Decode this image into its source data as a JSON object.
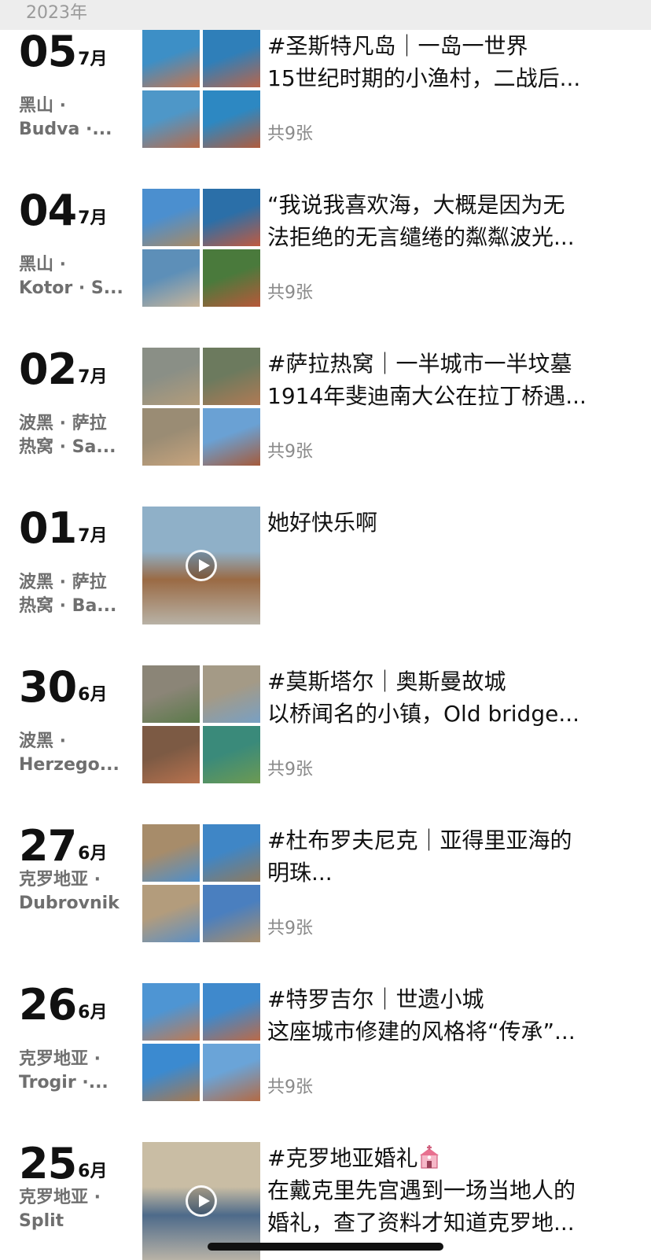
{
  "header": {
    "year": "2023年"
  },
  "posts": [
    {
      "day": "05",
      "month": "7月",
      "location_lines": [
        "黑山 ·",
        "Budva ·..."
      ],
      "title": "#圣斯特凡岛｜一岛一世界",
      "desc": "15世纪时期的小渔村，二战后...",
      "count": "共9张",
      "media": "grid",
      "thumb_colors": [
        [
          "#3d8fc6",
          "#c8744c"
        ],
        [
          "#2f7fb9",
          "#b9654a"
        ],
        [
          "#4e97c8",
          "#b96a48"
        ],
        [
          "#2d88c2",
          "#b15c3d"
        ]
      ]
    },
    {
      "day": "04",
      "month": "7月",
      "location_lines": [
        "黑山 ·",
        "Kotor · S..."
      ],
      "title": "“我说我喜欢海，大概是因为无",
      "desc": "法拒绝的无言缱绻的粼粼波光...",
      "count": "共9张",
      "media": "grid",
      "thumb_colors": [
        [
          "#4b8fcf",
          "#a98a64"
        ],
        [
          "#2b6fa8",
          "#c15a3f"
        ],
        [
          "#5d8fb8",
          "#c9b59a"
        ],
        [
          "#4a7a3c",
          "#b8583a"
        ]
      ]
    },
    {
      "day": "02",
      "month": "7月",
      "location_lines": [
        "波黑 · 萨拉",
        "热窝 · Sa..."
      ],
      "title": "#萨拉热窝｜一半城市一半坟墓",
      "desc": "1914年斐迪南大公在拉丁桥遇...",
      "count": "共9张",
      "media": "grid",
      "thumb_colors": [
        [
          "#8a8f86",
          "#b39c7a"
        ],
        [
          "#6c7a5e",
          "#b07a54"
        ],
        [
          "#9a8c74",
          "#c7a47d"
        ],
        [
          "#6aa1d4",
          "#a55a3a"
        ]
      ]
    },
    {
      "day": "01",
      "month": "7月",
      "location_lines": [
        "波黑 · 萨拉",
        "热窝 · Ba..."
      ],
      "title": "她好快乐啊",
      "desc": "",
      "count": "",
      "media": "video",
      "thumb_colors": [
        [
          "#8fb0c8",
          "#9a6a44"
        ]
      ]
    },
    {
      "day": "30",
      "month": "6月",
      "location_lines": [
        "波黑 ·",
        "Herzego..."
      ],
      "title": "#莫斯塔尔｜奥斯曼故城",
      "desc": "以桥闻名的小镇，Old bridge...",
      "count": "共9张",
      "media": "grid",
      "thumb_colors": [
        [
          "#8b8577",
          "#5b7a4a"
        ],
        [
          "#a49a86",
          "#78a0c4"
        ],
        [
          "#7c5a44",
          "#b8724e"
        ],
        [
          "#3a8a7a",
          "#6d9a52"
        ]
      ]
    },
    {
      "day": "27",
      "month": "6月",
      "location_lines": [
        "克罗地亚 ·",
        "Dubrovnik"
      ],
      "title": "#杜布罗夫尼克｜亚得里亚海的",
      "desc": "明珠...",
      "count": "共9张",
      "media": "grid",
      "thumb_colors": [
        [
          "#a78c6a",
          "#4d8fcc"
        ],
        [
          "#3f86c6",
          "#8f7a5e"
        ],
        [
          "#b39c7c",
          "#5b8fc4"
        ],
        [
          "#4a7fbf",
          "#a88e6c"
        ]
      ]
    },
    {
      "day": "26",
      "month": "6月",
      "location_lines": [
        "克罗地亚 ·",
        "Trogir ·..."
      ],
      "title": "#特罗吉尔｜世遗小城",
      "desc": "这座城市修建的风格将“传承”...",
      "count": "共9张",
      "media": "grid",
      "thumb_colors": [
        [
          "#4e95d3",
          "#c07a52"
        ],
        [
          "#3f89cc",
          "#bb6a48"
        ],
        [
          "#3b8ad0",
          "#a9784e"
        ],
        [
          "#6aa4d8",
          "#b46a44"
        ]
      ]
    },
    {
      "day": "25",
      "month": "6月",
      "location_lines": [
        "克罗地亚 ·",
        "Split"
      ],
      "title": "#克罗地亚婚礼",
      "desc": "在戴克里先宫遇到一场当地人的",
      "desc2": "婚礼，查了资料才知道克罗地...",
      "count": "",
      "media": "video",
      "icon": "wedding-chapel-icon",
      "thumb_colors": [
        [
          "#c9bda4",
          "#4d6a8a"
        ]
      ]
    }
  ]
}
